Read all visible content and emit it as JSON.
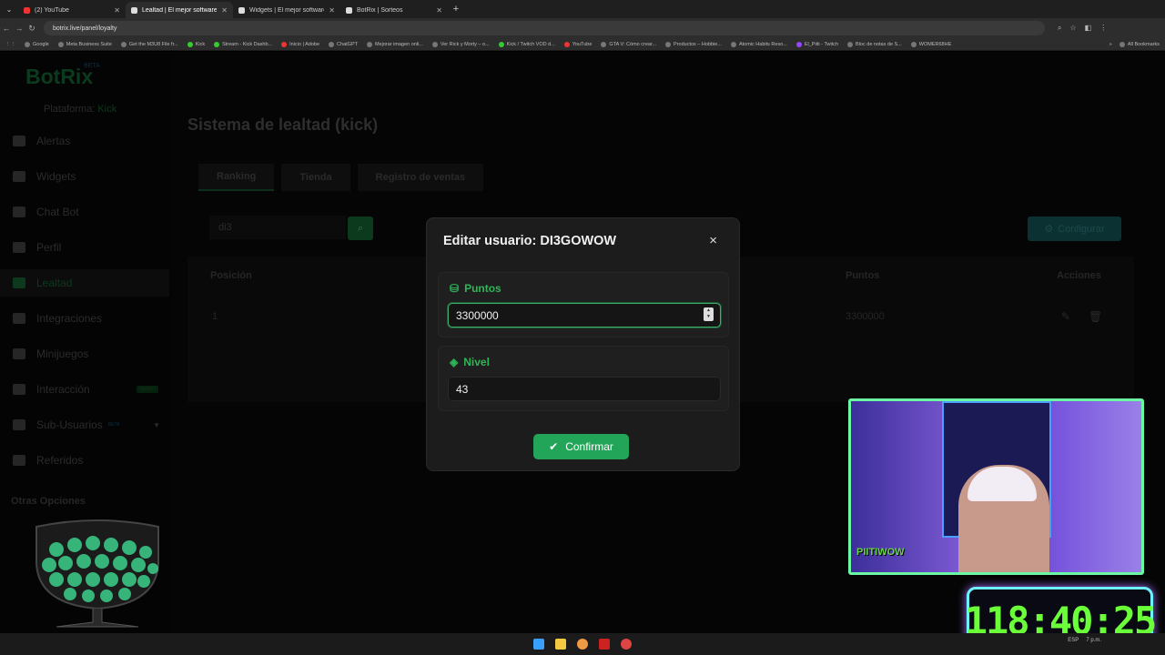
{
  "browser": {
    "tabs": [
      {
        "title": "(2) YouTube",
        "active": false
      },
      {
        "title": "Lealtad | El mejor software pa",
        "active": true
      },
      {
        "title": "Widgets | El mejor software pa",
        "active": false
      },
      {
        "title": "BotRix | Sorteos",
        "active": false
      }
    ],
    "url": "botrix.live/panel/loyalty",
    "bookmarks": [
      "Google",
      "Meta Business Suite",
      "Get the M3U8 File fr...",
      "Kick",
      "Stream - Kick Dashb...",
      "Inicio | Adobe",
      "ChatGPT",
      "Mejorar imagen onli...",
      "Ver Rick y Morty – o...",
      "Kick / Twitch VOD d...",
      "YouTube",
      "GTA V: Cómo crear...",
      "Productos – Hobbie...",
      "Atomic Habits Reso...",
      "El_Piiti - Twitch",
      "Bloc de notas de S...",
      "WOMER68HE"
    ],
    "all_bookmarks": "All Bookmarks"
  },
  "sidebar": {
    "logo": "BotRix",
    "beta": "BETA",
    "platform_label": "Plataforma:",
    "platform_value": "Kick",
    "items": [
      {
        "label": "Alertas"
      },
      {
        "label": "Widgets"
      },
      {
        "label": "Chat Bot"
      },
      {
        "label": "Perfil"
      },
      {
        "label": "Lealtad"
      },
      {
        "label": "Integraciones"
      },
      {
        "label": "Minijuegos"
      },
      {
        "label": "Interacción",
        "badge": "NUEVO"
      },
      {
        "label": "Sub-Usuarios",
        "badge": "BETA"
      },
      {
        "label": "Referidos"
      }
    ],
    "section": "Otras Opciones"
  },
  "main": {
    "title": "Sistema de lealtad (kick)",
    "tabs": [
      "Ranking",
      "Tienda",
      "Registro de ventas"
    ],
    "search_value": "di3",
    "config_label": "Configurar",
    "columns": {
      "position": "Posición",
      "points": "Puntos",
      "actions": "Acciones"
    },
    "row": {
      "position": "1",
      "points": "3300000"
    }
  },
  "modal": {
    "title": "Editar usuario: DI3GOWOW",
    "close": "×",
    "points_label": "Puntos",
    "points_value": "3300000",
    "level_label": "Nivel",
    "level_value": "43",
    "confirm_label": "Confirmar"
  },
  "overlay": {
    "cam_label": "PIITIWOW",
    "timer": "118:40:25"
  },
  "tray": {
    "lang": "ESP",
    "time": "7 p.m."
  }
}
